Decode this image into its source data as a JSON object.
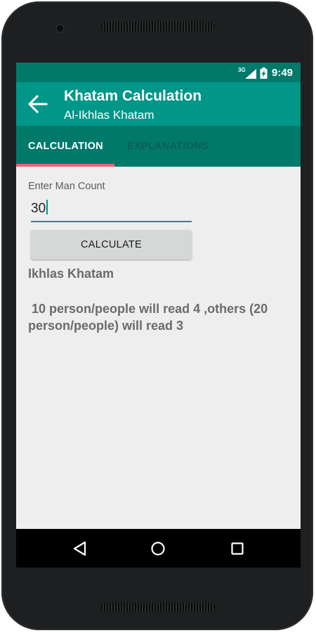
{
  "status_bar": {
    "network": "3G",
    "time": "9:49"
  },
  "app_bar": {
    "title": "Khatam Calculation",
    "subtitle": "Al-Ikhlas Khatam",
    "back_icon": "arrow-left"
  },
  "tabs": [
    {
      "label": "CALCULATION",
      "active": true
    },
    {
      "label": "EXPLANATIONS",
      "active": false
    }
  ],
  "form": {
    "field_label": "Enter Man Count",
    "man_count_value": "30",
    "calculate_label": "CALCULATE"
  },
  "result": {
    "title": "Ikhlas Khatam",
    "text": " 10 person/people will read 4 ,others (20 person/people) will read 3"
  },
  "colors": {
    "primary": "#009688",
    "primary_dark": "#00796b",
    "tab_indicator": "#f0637a",
    "background": "#eeeeee",
    "button": "#d6d7d7"
  },
  "nav_bar": {
    "icons": [
      "back-triangle",
      "home-circle",
      "recents-square"
    ]
  }
}
